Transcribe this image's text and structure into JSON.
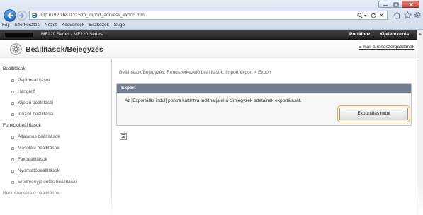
{
  "browser": {
    "address": "http://192.168.0.215/m_import_address_export.html",
    "menu": [
      "Fájl",
      "Szerkesztés",
      "Nézet",
      "Kedvencek",
      "Eszközök",
      "Súgó"
    ]
  },
  "header": {
    "device": "MF220 Series / MF220 Series/",
    "portal_link": "Portálhoz",
    "logout_link": "Kijelentkezés"
  },
  "title": {
    "text": "Beállítások/Bejegyzés",
    "admin_email_link": "E-mail a rendszergazdának"
  },
  "sidebar": {
    "sections": [
      {
        "heading": "Beállítások",
        "items": [
          "Papírbeállítások",
          "Hangerő",
          "Kijelző beállításai",
          "Időzítő beállításai"
        ]
      },
      {
        "heading": "Funkcióbeállítások",
        "items": [
          "Általános beállítások",
          "Másolási beállítások",
          "Faxbeállítások",
          "Nyomtatóbeállítások",
          "Eredményjelentés beállításai"
        ]
      },
      {
        "heading": "Rendszerkezelő beállítások"
      }
    ]
  },
  "main": {
    "breadcrumb": "Beállítások/Bejegyzés: Rendszerkezelő beállítások: Import/export > Export",
    "panel": {
      "heading": "Export",
      "description": "Az [Exportálás indul] pontra kattintva indíthatja el a címjegyzék adatainak exportálását.",
      "button_label": "Exportálás indul"
    }
  },
  "icons": {
    "window": [
      "minimize-icon",
      "maximize-icon",
      "close-icon"
    ],
    "navigation": [
      "back-arrow-icon",
      "forward-arrow-icon"
    ],
    "address_bar": [
      "ie-page-icon",
      "search-icon",
      "dropdown-caret-icon",
      "refresh-icon",
      "stop-icon"
    ],
    "toolbar": [
      "home-icon",
      "star-icon",
      "gear-icon"
    ],
    "title": "settings-circle-icon",
    "sidebar_bullet": "square-bullet-icon",
    "page_top": "page-top-arrow-icon"
  },
  "colors": {
    "header_bar": "#222222",
    "panel_header": "#6f7d8f",
    "highlight_ring": "#f2a43a",
    "window_close": "#c94b3f"
  }
}
